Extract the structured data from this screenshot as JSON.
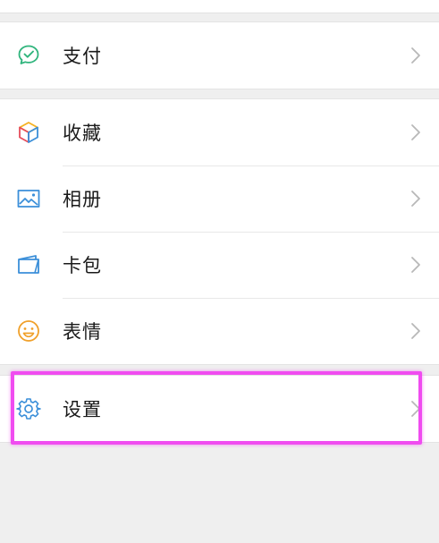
{
  "colors": {
    "pay_icon": "#2fb47c",
    "photos_icon": "#3b8fd9",
    "cards_icon": "#3b8fd9",
    "sticker_icon": "#f0a02a",
    "settings_icon": "#3b8fd9",
    "highlight": "#f04cf0"
  },
  "groups": [
    {
      "items": [
        {
          "label": "支付",
          "icon": "pay-check-icon"
        }
      ]
    },
    {
      "items": [
        {
          "label": "收藏",
          "icon": "favorites-cube-icon"
        },
        {
          "label": "相册",
          "icon": "photos-image-icon"
        },
        {
          "label": "卡包",
          "icon": "cards-wallet-icon"
        },
        {
          "label": "表情",
          "icon": "stickers-smile-icon"
        }
      ]
    },
    {
      "items": [
        {
          "label": "设置",
          "icon": "settings-gear-icon"
        }
      ]
    }
  ]
}
